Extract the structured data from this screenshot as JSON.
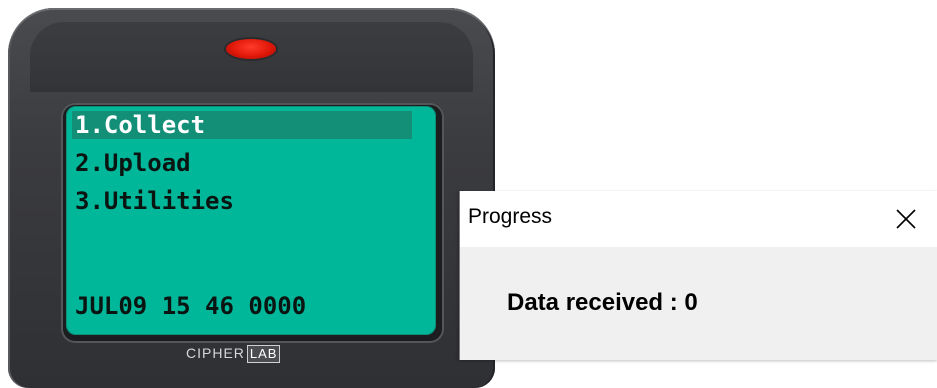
{
  "device": {
    "menu": [
      {
        "label": "1.Collect",
        "selected": true
      },
      {
        "label": "2.Upload",
        "selected": false
      },
      {
        "label": "3.Utilities",
        "selected": false
      }
    ],
    "status_line": "JUL09 15 46 0000",
    "brand_prefix": "CIPHER",
    "brand_box": "LAB",
    "colors": {
      "screen": "#00b79a",
      "selection": "#138f78",
      "led": "#e01809",
      "body": "#3b3c3f"
    }
  },
  "dialog": {
    "title": "Progress",
    "close_icon": "close-icon",
    "message": "Data received : 0"
  }
}
